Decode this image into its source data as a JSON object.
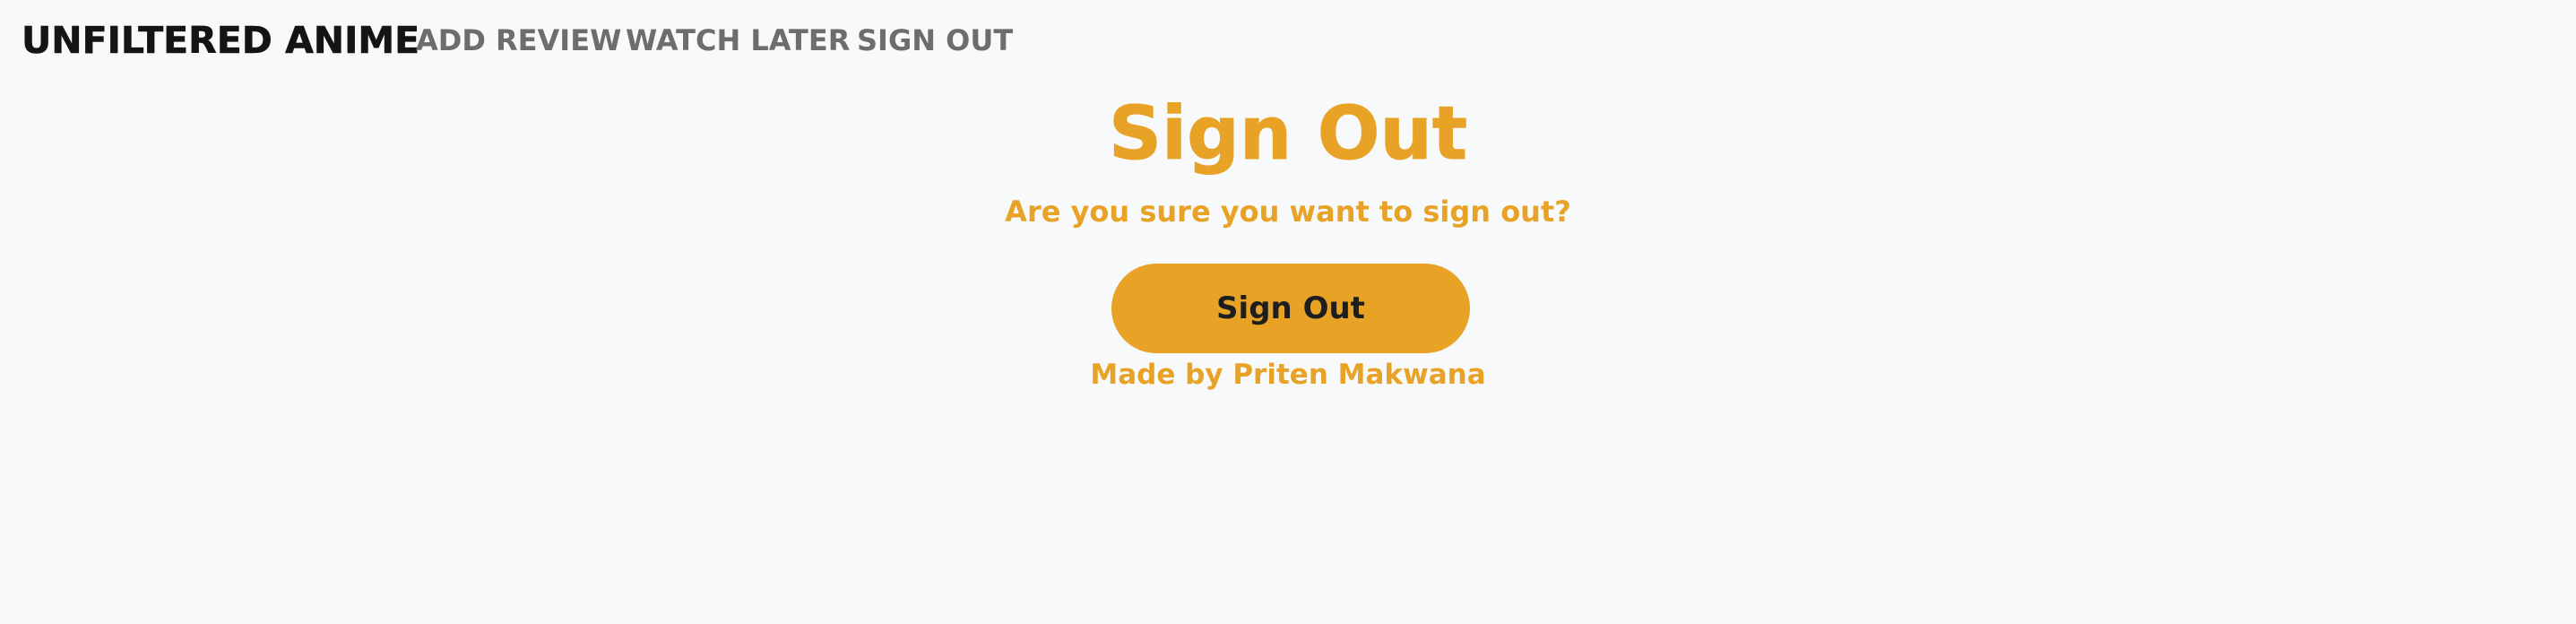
{
  "navbar": {
    "brand": "UNFILTERED ANIME",
    "links": [
      {
        "label": "ADD REVIEW"
      },
      {
        "label": "WATCH LATER"
      },
      {
        "label": "SIGN OUT"
      }
    ]
  },
  "main": {
    "title": "Sign Out",
    "subtitle": "Are you sure you want to sign out?",
    "button_label": "Sign Out",
    "credit": "Made by Priten Makwana"
  },
  "colors": {
    "accent": "#e8a326",
    "brand_text": "#141414",
    "nav_text": "#6d6d6d",
    "background": "#f8f9fa",
    "button_text": "#1e1e1e"
  }
}
